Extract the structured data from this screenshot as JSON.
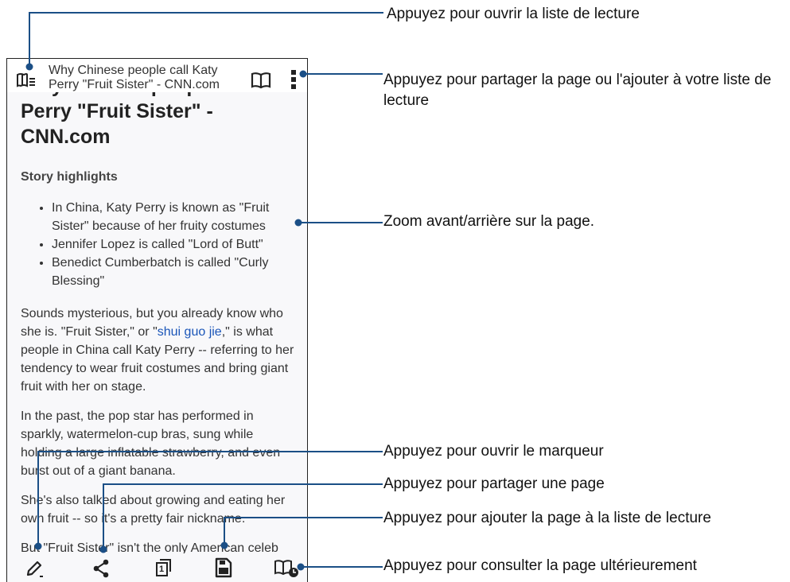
{
  "browser": {
    "tab_title": "Why Chinese people call Katy Perry \"Fruit Sister\" - CNN.com",
    "icons": {
      "reading_list": "reading-list-icon",
      "reader_mode": "reader-mode-icon",
      "more": "more-vert-icon",
      "marker": "pen-icon",
      "share": "share-icon",
      "tabs": "tabs-icon",
      "save": "save-icon",
      "read_later": "read-later-icon"
    },
    "tab_count": "1"
  },
  "article": {
    "headline": "Why Chinese people call Katy Perry \"Fruit Sister\" - CNN.com",
    "headline_line1": "Why Chinese people call Katy",
    "headline_line2": "Perry \"Fruit Sister\" - CNN.com",
    "highlights_title": "Story highlights",
    "highlights": [
      "In China, Katy Perry is known as \"Fruit Sister\" because of her fruity costumes",
      "Jennifer Lopez is called \"Lord of Butt\"",
      "Benedict Cumberbatch is called \"Curly Blessing\""
    ],
    "p1_before": "Sounds mysterious, but you already know who she is. \"Fruit Sister,\" or \"",
    "p1_link": "shui guo jie",
    "p1_after": ",\" is what people in China call Katy Perry -- referring to her tendency to wear fruit costumes and bring giant fruit with her on stage.",
    "p2": "In the past, the pop star has performed in sparkly, watermelon-cup bras, sung while holding a large inflatable strawberry, and even burst out of a giant banana.",
    "p3": "She's also talked about growing and eating her own fruit -- so it's a pretty fair nickname.",
    "p4": "But \"Fruit Sister\" isn't the only American celeb"
  },
  "callouts": {
    "reading_list": "Appuyez pour ouvrir la liste de lecture",
    "share_or_add": "Appuyez pour partager la page ou l'ajouter à votre liste de lecture",
    "zoom": "Zoom avant/arrière sur la page.",
    "marker": "Appuyez pour ouvrir le marqueur",
    "share_page": "Appuyez pour partager une page",
    "add_to_list": "Appuyez pour ajouter la page à la liste de lecture",
    "read_later": "Appuyez pour consulter la page ultérieurement"
  },
  "colors": {
    "callout_line": "#1b4f86",
    "link": "#1a55b8"
  }
}
